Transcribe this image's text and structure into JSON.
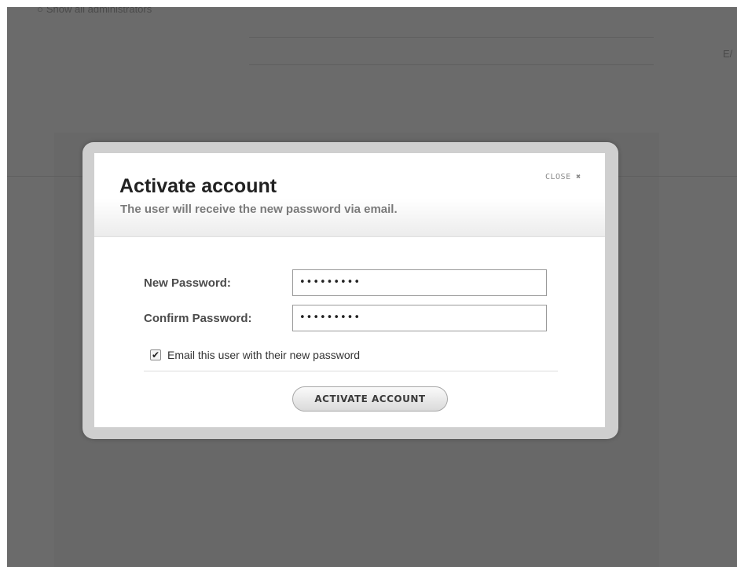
{
  "background": {
    "link_text": "Show all administrators",
    "fragment_right": "E/"
  },
  "modal": {
    "title": "Activate account",
    "subtitle": "The user will receive the new password via email.",
    "close_label": "CLOSE",
    "close_icon": "close-x-icon",
    "fields": [
      {
        "label": "New Password:",
        "value": "•••••••••"
      },
      {
        "label": "Confirm Password:",
        "value": "•••••••••"
      }
    ],
    "email_checkbox": {
      "label": "Email this user with their new password",
      "checked": true
    },
    "submit_label": "ACTIVATE ACCOUNT"
  },
  "colors": {
    "overlay": "#6b6b6b",
    "modal_frame": "#cfcfcf",
    "title": "#222222",
    "subtitle": "#7a7a7a"
  }
}
